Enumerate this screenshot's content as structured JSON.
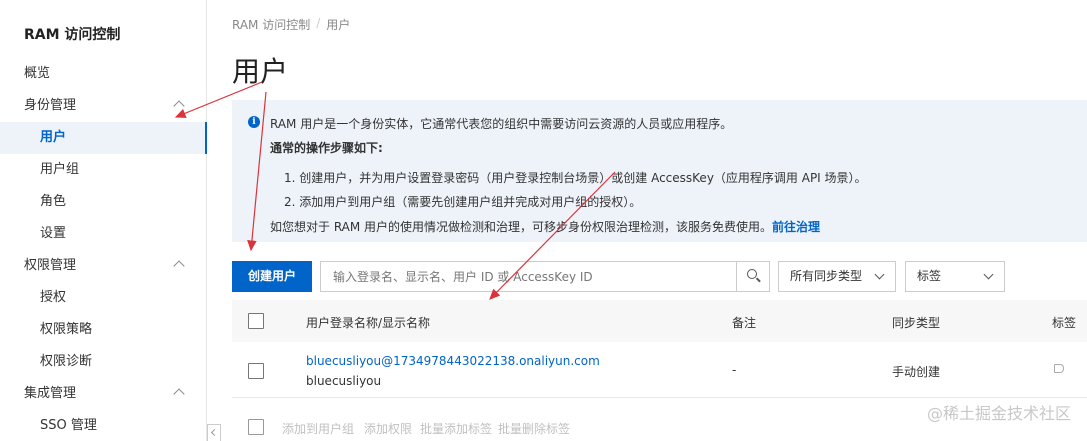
{
  "sidebar": {
    "app_title": "RAM 访问控制",
    "items": [
      {
        "label": "概览"
      },
      {
        "label": "身份管理"
      },
      {
        "label": "用户"
      },
      {
        "label": "用户组"
      },
      {
        "label": "角色"
      },
      {
        "label": "设置"
      },
      {
        "label": "权限管理"
      },
      {
        "label": "授权"
      },
      {
        "label": "权限策略"
      },
      {
        "label": "权限诊断"
      },
      {
        "label": "集成管理"
      },
      {
        "label": "SSO 管理"
      }
    ]
  },
  "breadcrumb": [
    "RAM 访问控制",
    "/",
    "用户"
  ],
  "page_title": "用户",
  "info": {
    "line1": "RAM 用户是一个身份实体，它通常代表您的组织中需要访问云资源的人员或应用程序。",
    "line2": "通常的操作步骤如下:",
    "step1": "1. 创建用户，并为用户设置登录密码（用户登录控制台场景）或创建 AccessKey（应用程序调用 API 场景）。",
    "step2": "2. 添加用户到用户组（需要先创建用户组并完成对用户组的授权）。",
    "line5": "如您想对于 RAM 用户的使用情况做检测和治理，可移步身份权限治理检测，该服务免费使用。",
    "link": "前往治理"
  },
  "toolbar": {
    "create_label": "创建用户",
    "search_placeholder": "输入登录名、显示名、用户 ID 或 AccessKey ID",
    "sync_select": "所有同步类型",
    "tag_select": "标签"
  },
  "table": {
    "headers": [
      "用户登录名称/显示名称",
      "备注",
      "同步类型",
      "标签"
    ],
    "rows": [
      {
        "login": "bluecusliyou@1734978443022138.onaliyun.com",
        "display": "bluecusliyou",
        "note": "-",
        "sync": "手动创建"
      }
    ],
    "bulk_actions": [
      "添加到用户组",
      "添加权限",
      "批量添加标签",
      "批量删除标签"
    ]
  },
  "watermark": "@稀土掘金技术社区",
  "colors": {
    "primary": "#0064c8",
    "info_bg": "#eef3fa",
    "annotation": "#d9343a"
  }
}
